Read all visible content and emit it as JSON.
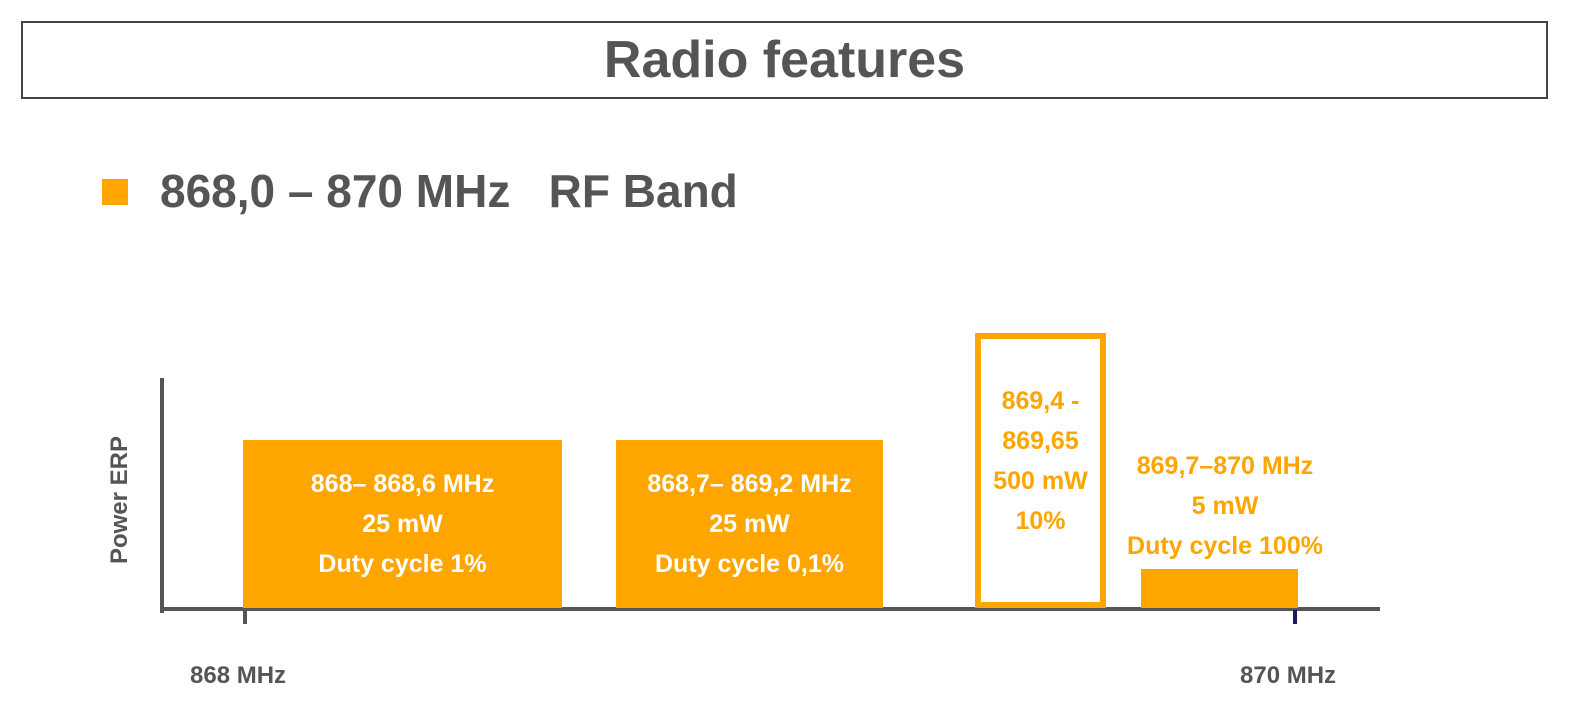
{
  "title": "Radio features",
  "subtitle": "868,0 – 870 MHz   RF Band",
  "accent_color": "#FFA500",
  "axis": {
    "y_label": "Power ERP",
    "x_start_label": "868 MHz",
    "x_end_label": "870 MHz"
  },
  "bands": [
    {
      "range": "868– 868,6 MHz",
      "power": "25 mW",
      "duty": "Duty cycle 1%",
      "style": "filled"
    },
    {
      "range": "868,7– 869,2 MHz",
      "power": "25 mW",
      "duty": "Duty cycle 0,1%",
      "style": "filled"
    },
    {
      "range_line1": "869,4 -",
      "range_line2": "869,65",
      "power": "500 mW",
      "duty": "10%",
      "style": "outline"
    },
    {
      "range": "869,7–870 MHz",
      "power": "5 mW",
      "duty": "Duty cycle 100%",
      "style": "filled-small"
    }
  ]
}
